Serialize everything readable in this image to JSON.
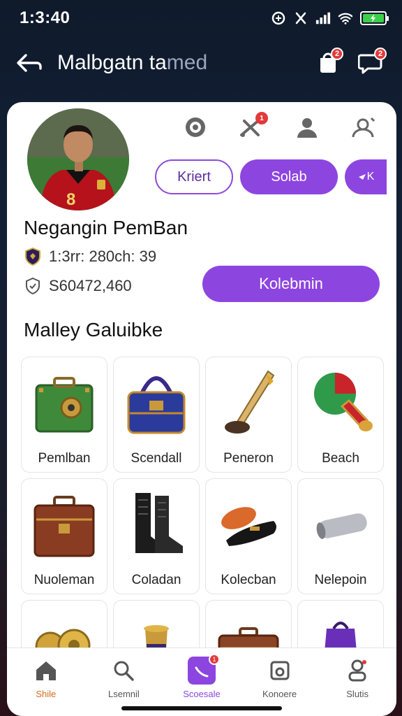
{
  "status_bar": {
    "time": "1:3:40"
  },
  "header": {
    "title_main": "Malbgatn ta",
    "title_faded": "med"
  },
  "header_badges": {
    "notifications": "2",
    "messages": "2"
  },
  "profile": {
    "jersey_number": "8",
    "action_badge": "1",
    "pills": [
      "Kriert",
      "Solab",
      "K"
    ],
    "name": "Negangin PemBan",
    "stat1": "1:3rr: 280ch: 39",
    "stat2": "S60472,460",
    "collect_button": "Kolebmin"
  },
  "section_title": "Malley Galuibke",
  "items": [
    {
      "label": "Pemlban",
      "icon": "green-safe-icon"
    },
    {
      "label": "Scendall",
      "icon": "blue-chest-icon"
    },
    {
      "label": "Peneron",
      "icon": "vuvuzela-horn-icon"
    },
    {
      "label": "Beach",
      "icon": "red-horn-icon"
    },
    {
      "label": "Nuoleman",
      "icon": "brown-suitcase-icon"
    },
    {
      "label": "Coladan",
      "icon": "black-boots-icon"
    },
    {
      "label": "Kolecban",
      "icon": "loafer-shoes-icon"
    },
    {
      "label": "Nelepoin",
      "icon": "metal-cylinder-icon"
    },
    {
      "label": "",
      "icon": "gold-coins-icon"
    },
    {
      "label": "",
      "icon": "trophy-cup-icon"
    },
    {
      "label": "",
      "icon": "briefcase-icon"
    },
    {
      "label": "",
      "icon": "purple-bag-icon"
    }
  ],
  "nav": {
    "items": [
      {
        "label": "Shile"
      },
      {
        "label": "Lsemnil"
      },
      {
        "label": "Scoesale",
        "badge": "1"
      },
      {
        "label": "Konoere"
      },
      {
        "label": "Slutis"
      }
    ]
  },
  "colors": {
    "accent": "#8d45e0",
    "badge": "#e23a3a",
    "active_nav": "#d2691e"
  }
}
